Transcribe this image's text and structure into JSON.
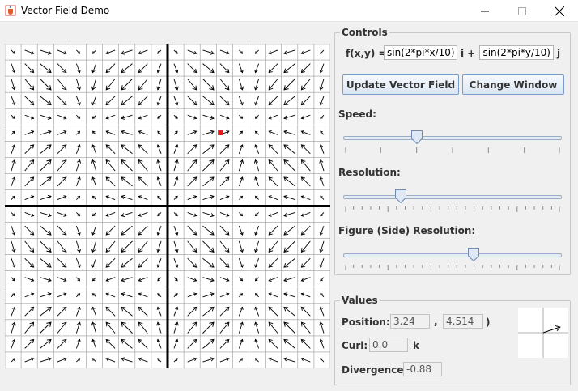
{
  "window": {
    "title": "Vector Field Demo",
    "icon": "java-cup-icon",
    "minimize_icon": "minimize-icon",
    "maximize_icon": "maximize-icon",
    "close_icon": "close-icon"
  },
  "controls": {
    "legend": "Controls",
    "function_label": "f(x,y) =",
    "fx_value": "sin(2*pi*x/10)",
    "i_label": "i +",
    "fy_value": "sin(2*pi*y/10)",
    "j_label": "j",
    "update_button": "Update Vector Field",
    "change_window_button": "Change Window",
    "speed_label": "Speed:",
    "speed_level": 0.33,
    "resolution_label": "Resolution:",
    "resolution_level": 0.25,
    "figure_resolution_label": "Figure (Side) Resolution:",
    "figure_resolution_level": 0.6
  },
  "values": {
    "legend": "Values",
    "position_label": "Position: (",
    "position_x": "3.24",
    "position_sep": ",",
    "position_y": "4.514",
    "position_close": ")",
    "curl_label": "Curl:",
    "curl_value": "0.0",
    "curl_unit": "k",
    "divergence_label": "Divergence:",
    "divergence_value": "-0.88"
  },
  "field": {
    "x_range": [
      -10,
      10
    ],
    "y_range": [
      -10,
      10
    ],
    "particle": {
      "x": 3.24,
      "y": 4.514
    },
    "particle_color": "#e02020",
    "arrow_color": "#000000"
  }
}
